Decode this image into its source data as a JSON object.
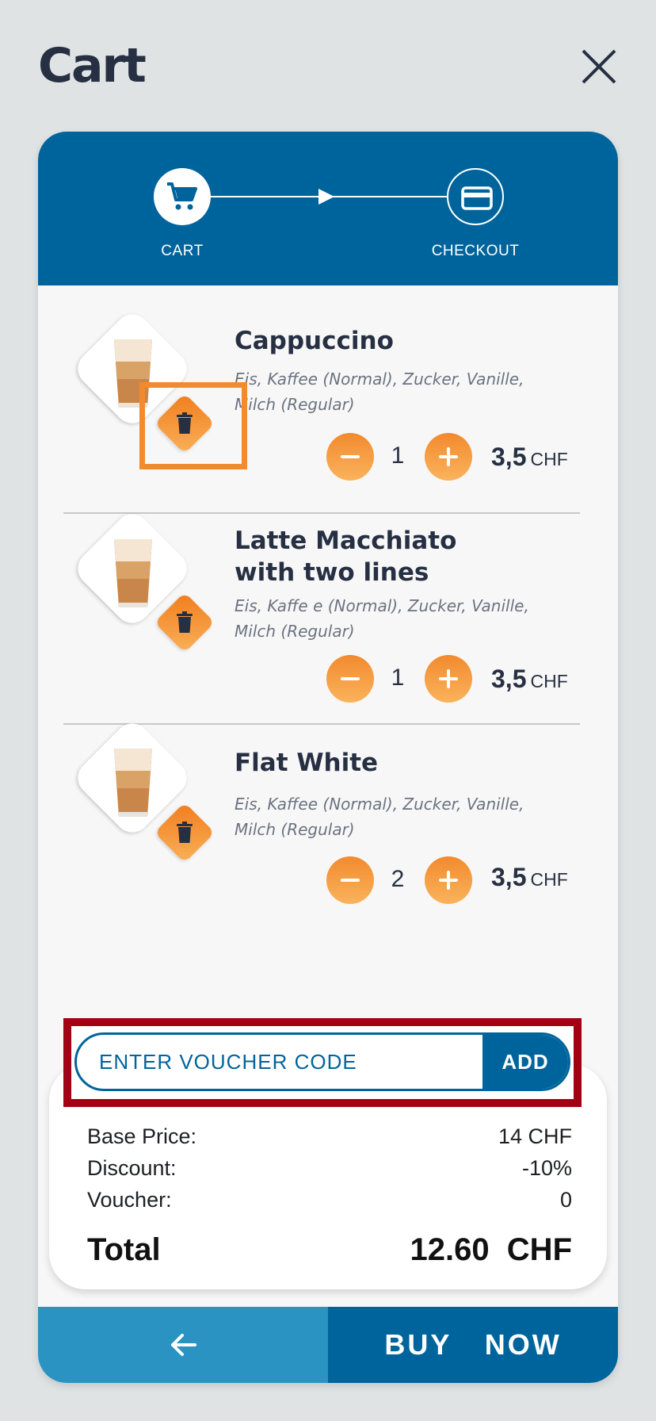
{
  "header": {
    "title": "Cart",
    "close_icon": "close-icon"
  },
  "stepper": {
    "steps": [
      {
        "label": "CART",
        "icon": "cart-icon",
        "active": true
      },
      {
        "label": "CHECKOUT",
        "icon": "credit-card-icon",
        "active": false
      }
    ]
  },
  "items": [
    {
      "name": "Cappuccino",
      "desc": "Eis, Kaffee (Normal), Zucker, Vanille, Milch (Regular)",
      "qty": "1",
      "price": "3,5",
      "currency": "CHF"
    },
    {
      "name": "Latte Macchiato with two lines",
      "desc": "Eis, Kaffe e (Normal), Zucker, Vanille, Milch (Regular)",
      "qty": "1",
      "price": "3,5",
      "currency": "CHF"
    },
    {
      "name": "Flat White",
      "desc": "Eis, Kaffee (Normal), Zucker, Vanille, Milch (Regular)",
      "qty": "2",
      "price": "3,5",
      "currency": "CHF"
    }
  ],
  "voucher": {
    "placeholder": "ENTER VOUCHER CODE",
    "add_label": "ADD"
  },
  "summary": {
    "base_label": "Base Price:",
    "base_value": "14 CHF",
    "discount_label": "Discount:",
    "discount_value": "-10%",
    "voucher_label": "Voucher:",
    "voucher_value": "0",
    "total_label": "Total",
    "total_value": "12.60  CHF"
  },
  "actions": {
    "back_icon": "arrow-left-icon",
    "buy_label": "BUY  NOW"
  },
  "colors": {
    "primary": "#00649c",
    "secondary": "#2a93c2",
    "accent": "#f28a2e",
    "highlight_red": "#a30013"
  }
}
